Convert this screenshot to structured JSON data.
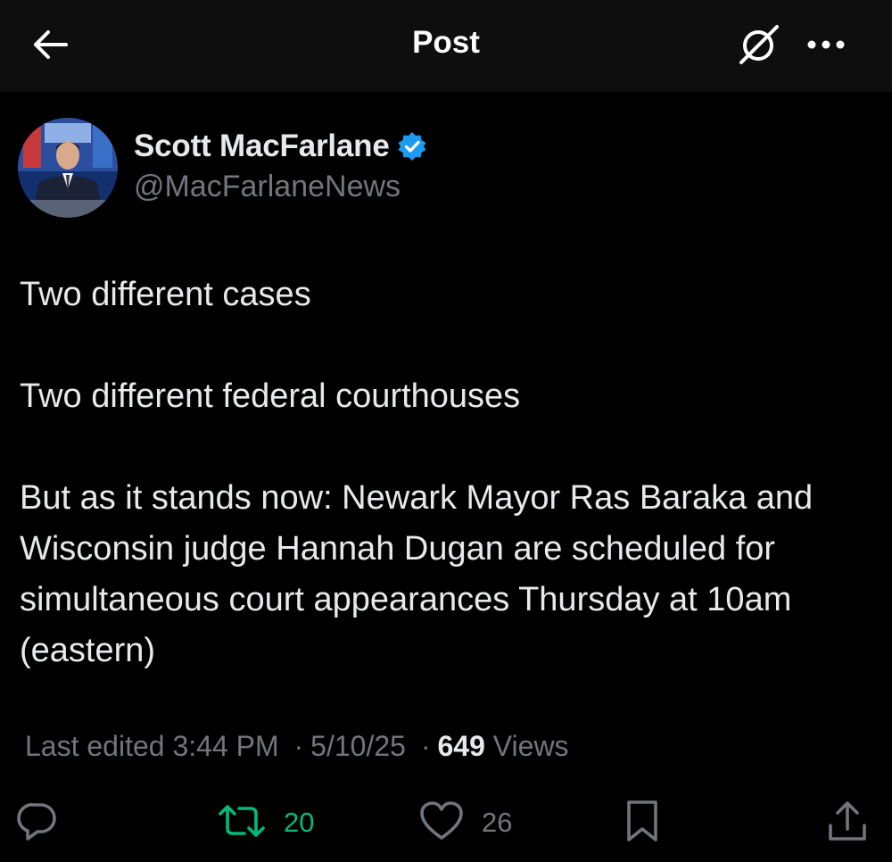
{
  "header": {
    "title": "Post"
  },
  "author": {
    "name": "Scott MacFarlane",
    "handle": "@MacFarlaneNews",
    "verified": true
  },
  "post": {
    "paragraphs": [
      "Two different cases",
      "Two different federal courthouses",
      "But as it stands now:  Newark Mayor Ras Baraka and Wisconsin judge Hannah Dugan are scheduled for simultaneous court appearances Thursday at 10am (eastern)"
    ]
  },
  "meta": {
    "edited_label": "Last edited",
    "time": "3:44 PM",
    "date": "5/10/25",
    "views_count": "649",
    "views_label": "Views",
    "separator": "·"
  },
  "actions": {
    "replies": "",
    "reposts": "20",
    "likes": "26"
  },
  "colors": {
    "background": "#000000",
    "topbar": "#0e0e0e",
    "text": "#e7e9ea",
    "muted": "#71767b",
    "verified_blue": "#1d9bf0",
    "repost_green": "#00ba7c"
  },
  "icons": {
    "back": "arrow-left-icon",
    "grok": "grok-icon",
    "more": "more-horizontal-icon",
    "verified": "verified-badge-icon",
    "reply": "reply-icon",
    "repost": "repost-icon",
    "like": "heart-icon",
    "bookmark": "bookmark-icon",
    "share": "share-icon"
  }
}
